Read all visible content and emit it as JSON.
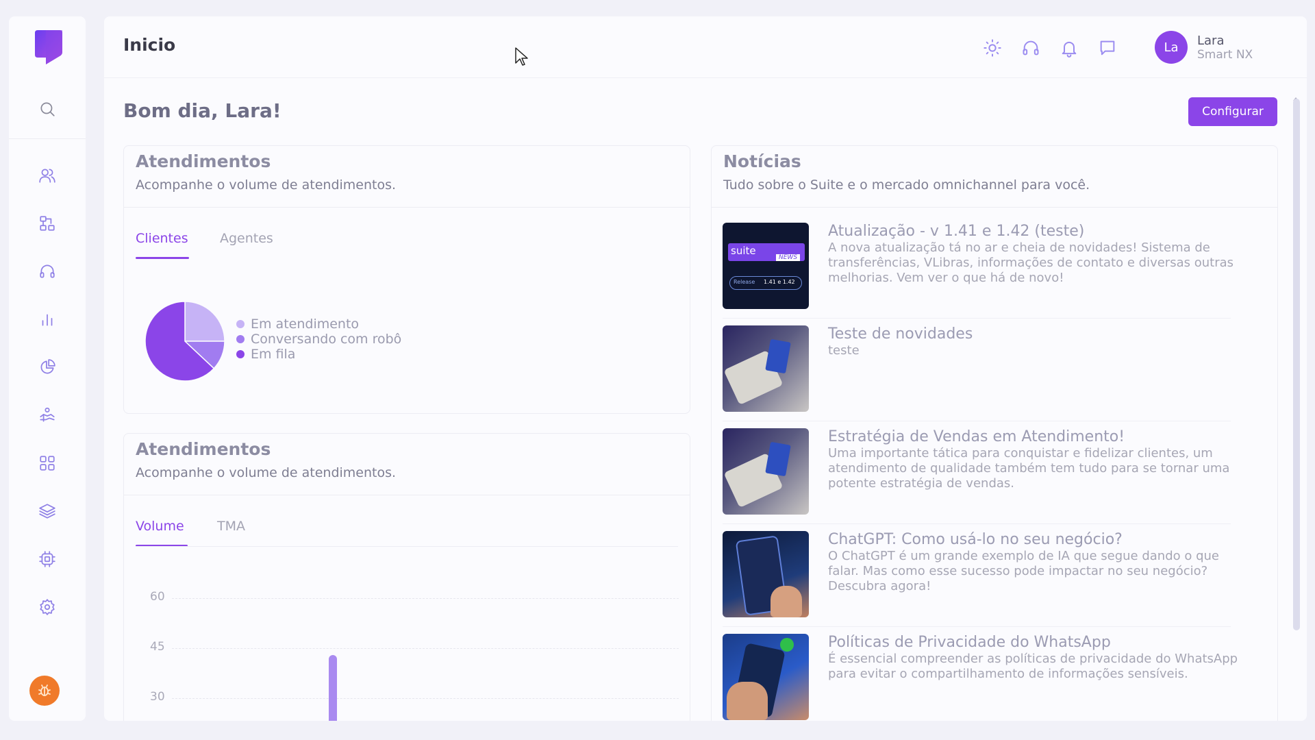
{
  "header": {
    "title": "Inicio",
    "user": {
      "initials": "La",
      "name": "Lara",
      "company": "Smart NX"
    },
    "icons": [
      "sun-icon",
      "headset-icon",
      "bell-icon",
      "chat-icon"
    ]
  },
  "greeting": "Bom dia, Lara!",
  "configure_label": "Configurar",
  "sidebar": {
    "items": [
      {
        "name": "search-icon"
      },
      {
        "name": "users-icon"
      },
      {
        "name": "flow-icon"
      },
      {
        "name": "headset-icon"
      },
      {
        "name": "bar-chart-icon"
      },
      {
        "name": "pie-chart-icon"
      },
      {
        "name": "handshake-icon"
      },
      {
        "name": "apps-grid-icon"
      },
      {
        "name": "layers-icon"
      },
      {
        "name": "cpu-icon"
      },
      {
        "name": "settings-icon"
      }
    ]
  },
  "card1": {
    "title": "Atendimentos",
    "subtitle": "Acompanhe o volume de atendimentos.",
    "tabs": [
      {
        "label": "Clientes",
        "active": true
      },
      {
        "label": "Agentes",
        "active": false
      }
    ],
    "legend": [
      {
        "label": "Em atendimento",
        "color": "#c6b3f6"
      },
      {
        "label": "Conversando com robô",
        "color": "#a17cf0"
      },
      {
        "label": "Em fila",
        "color": "#8b45e8"
      }
    ]
  },
  "card2": {
    "title": "Atendimentos",
    "subtitle": "Acompanhe o volume de atendimentos.",
    "tabs": [
      {
        "label": "Volume",
        "active": true
      },
      {
        "label": "TMA",
        "active": false
      }
    ],
    "y_ticks": [
      "60",
      "45",
      "30"
    ]
  },
  "chart_data": [
    {
      "type": "pie",
      "categories": [
        "Em atendimento",
        "Conversando com robô",
        "Em fila"
      ],
      "values": [
        25,
        12,
        63
      ],
      "colors": [
        "#c6b3f6",
        "#a17cf0",
        "#8b45e8"
      ]
    },
    {
      "type": "bar",
      "ylim": [
        30,
        60
      ],
      "yticks": [
        60,
        45,
        30
      ],
      "series": [
        {
          "values": [
            43
          ]
        }
      ],
      "color": "#a98af0"
    }
  ],
  "news": {
    "title": "Notícias",
    "subtitle": "Tudo sobre o Suite e o mercado omnichannel para você.",
    "thumb_suite_text": {
      "brand": "suite",
      "tag": "NEWS",
      "release": "Release",
      "version": "1.41 e 1.42"
    },
    "items": [
      {
        "title": "Atualização - v 1.41 e 1.42 (teste)",
        "text": "A nova atualização tá no ar e cheia de novidades! Sistema de transferências, VLibras, informações de contato e diversas outras melhorias. Vem ver o que há de novo!",
        "thumb": "suite"
      },
      {
        "title": "Teste de novidades",
        "text": "teste",
        "thumb": "card"
      },
      {
        "title": "Estratégia de Vendas em Atendimento!",
        "text": "Uma importante tática para conquistar e fidelizar clientes, um atendimento de qualidade também tem tudo para se tornar uma potente estratégia de vendas.",
        "thumb": "card"
      },
      {
        "title": "ChatGPT: Como usá-lo no seu negócio?",
        "text": "O ChatGPT é um grande exemplo de IA que segue dando o que falar. Mas como esse sucesso pode impactar no seu negócio? Descubra agora!",
        "thumb": "phone"
      },
      {
        "title": "Políticas de Privacidade do WhatsApp",
        "text": "É essencial compreender as políticas de privacidade do WhatsApp para evitar o compartilhamento de informações sensíveis.",
        "thumb": "whatsapp"
      }
    ]
  }
}
